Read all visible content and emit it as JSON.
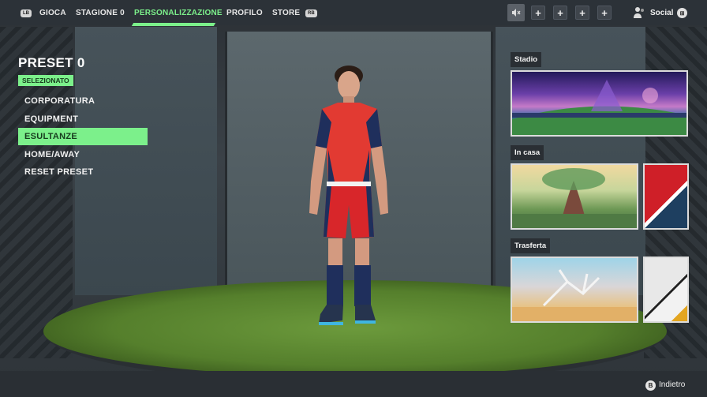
{
  "topbar": {
    "lb_key": "LB",
    "rb_key": "RB",
    "nav": [
      {
        "label": "GIOCA"
      },
      {
        "label": "STAGIONE 0"
      },
      {
        "label": "PERSONALIZZAZIONE",
        "active": true
      },
      {
        "label": "PROFILO"
      },
      {
        "label": "STORE"
      }
    ],
    "mute_icon": "speaker-muted-icon",
    "social_label": "Social",
    "social_key": "⊞"
  },
  "menu": {
    "preset_title": "PRESET 0",
    "badge": "SELEZIONATO",
    "items": [
      {
        "label": "CORPORATURA"
      },
      {
        "label": "EQUIPMENT"
      },
      {
        "label": "ESULTANZE",
        "selected": true
      },
      {
        "label": "HOME/AWAY"
      },
      {
        "label": "RESET PRESET"
      }
    ]
  },
  "right_panel": {
    "stadium_label": "Stadio",
    "home_label": "In casa",
    "away_label": "Trasferta"
  },
  "footer": {
    "back_key": "B",
    "back_label": "Indietro"
  },
  "colors": {
    "accent": "#7cf08b",
    "kit_home_primary": "#cf1f28",
    "kit_home_secondary": "#1e3f60",
    "kit_away_primary": "#e8e8e8",
    "kit_away_accent": "#e3a520"
  }
}
